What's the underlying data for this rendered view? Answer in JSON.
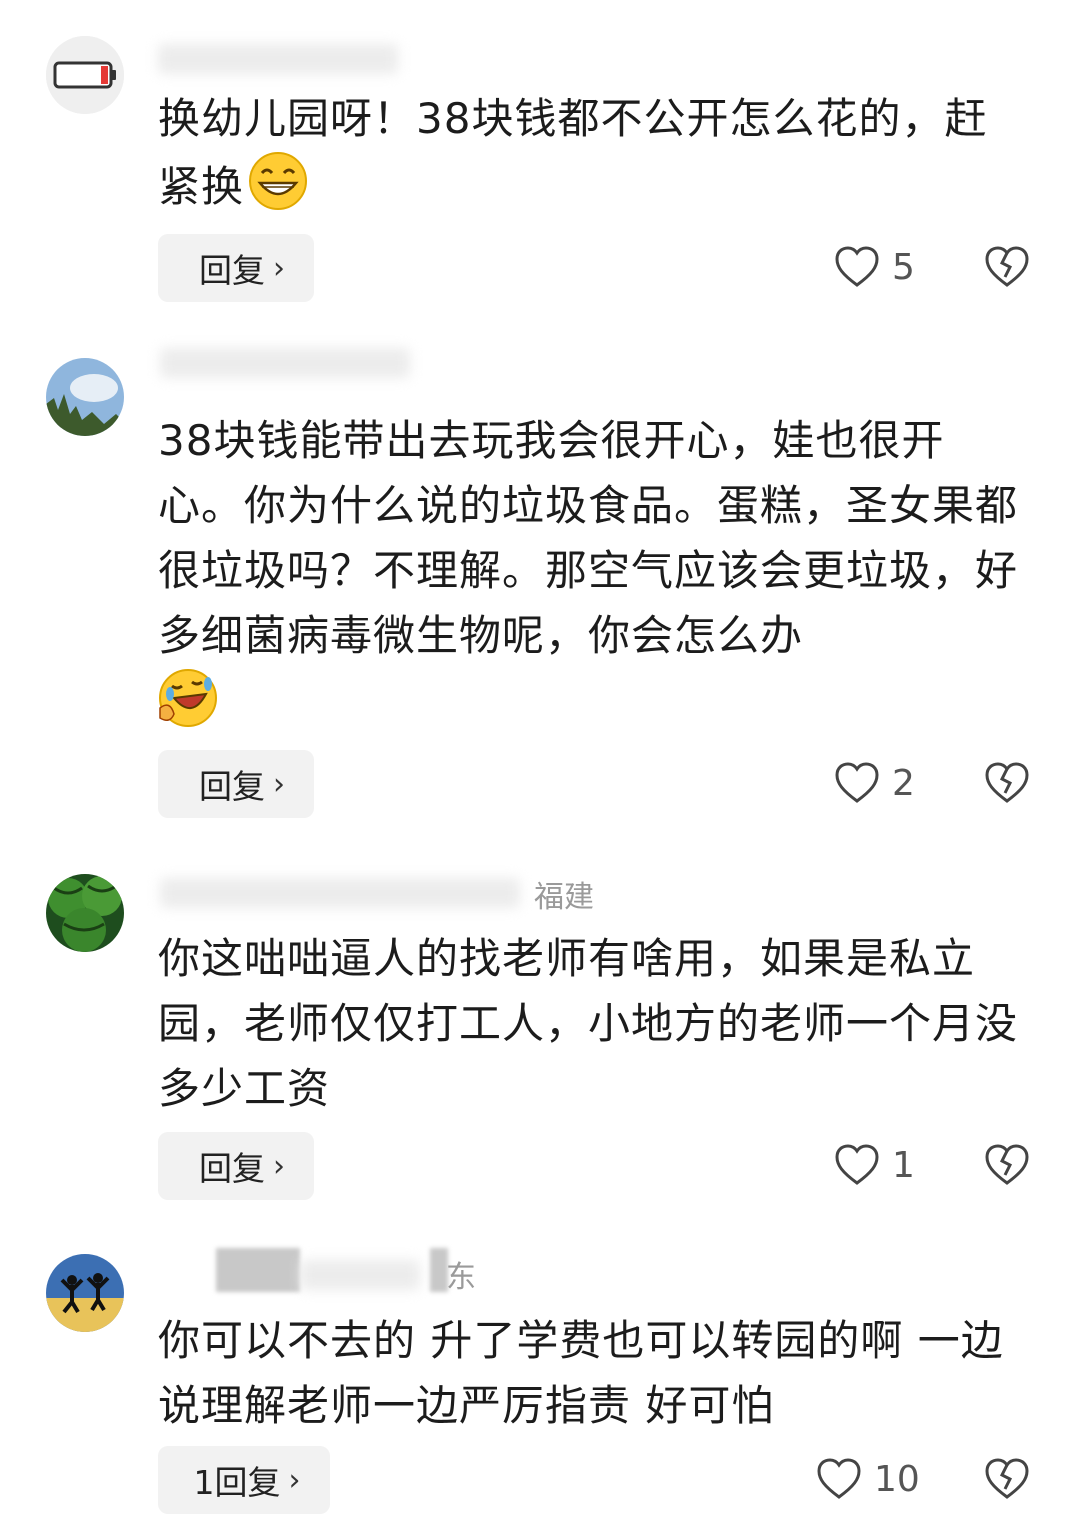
{
  "comments": [
    {
      "text": "换幼儿园呀！38块钱都不公开怎么花的，赶紧换",
      "emoji": "grinning-face-emoji",
      "reply_label": "回复",
      "likes": "5",
      "avatar_icon": "battery-low-icon",
      "location": ""
    },
    {
      "text": "38块钱能带出去玩我会很开心，娃也很开心。你为什么说的垃圾食品。蛋糕，圣女果都很垃圾吗？不理解。那空气应该会更垃圾，好多细菌病毒微生物呢，你会怎么办",
      "emoji": "rolling-laughing-emoji",
      "reply_label": "回复",
      "likes": "2",
      "avatar_icon": "sky-trees-icon",
      "location": ""
    },
    {
      "text": "你这咄咄逼人的找老师有啥用，如果是私立园，老师仅仅打工人，小地方的老师一个月没多少工资",
      "emoji": "",
      "reply_label": "回复",
      "likes": "1",
      "avatar_icon": "watermelon-icon",
      "location": "福建"
    },
    {
      "text": "你可以不去的 升了学费也可以转园的啊 一边说理解老师一边严厉指责 好可怕",
      "emoji": "",
      "reply_label": "1回复",
      "likes": "10",
      "avatar_icon": "jumping-people-icon",
      "location": "东"
    }
  ],
  "colors": {
    "text": "#1c1c1c",
    "meta": "#9a9a9a",
    "button_bg": "#f2f2f2",
    "battery_red": "#e53935"
  }
}
